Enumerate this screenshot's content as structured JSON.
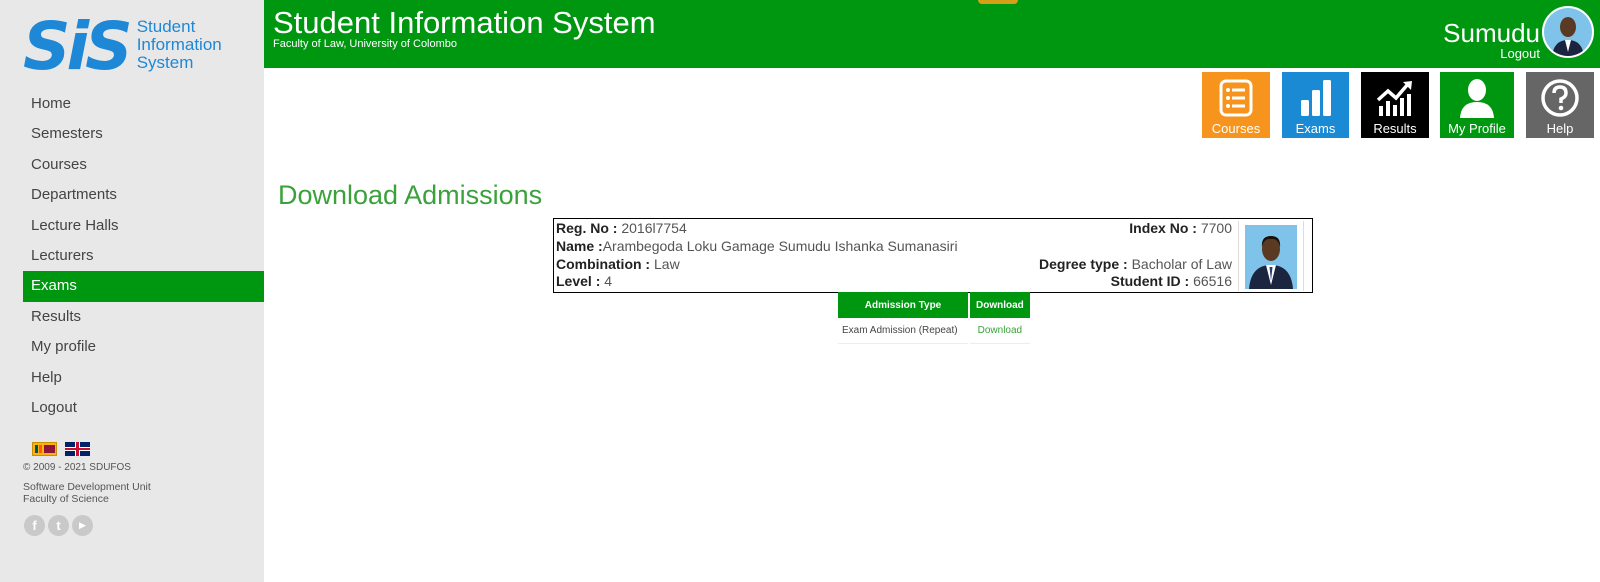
{
  "logo": {
    "mark": "SiS",
    "line1": "Student",
    "line2": "Information",
    "line3": "System"
  },
  "nav": {
    "items": [
      "Home",
      "Semesters",
      "Courses",
      "Departments",
      "Lecture Halls",
      "Lecturers",
      "Exams",
      "Results",
      "My profile",
      "Help",
      "Logout"
    ],
    "active": "Exams"
  },
  "footer": {
    "copyright": "© 2009 - 2021 SDUFOS",
    "unit_line1": "Software Development Unit",
    "unit_line2": "Faculty of Science"
  },
  "social": {
    "facebook": "f",
    "twitter": "t",
    "youtube": "▶"
  },
  "header": {
    "title": "Student Information System",
    "subtitle": "Faculty of Law, University of Colombo",
    "user_name": "Sumudu",
    "logout": "Logout"
  },
  "tiles": [
    {
      "label": "Courses",
      "icon": "list-icon",
      "color": "#f7941d"
    },
    {
      "label": "Exams",
      "icon": "bar-chart-icon",
      "color": "#1a8ad4"
    },
    {
      "label": "Results",
      "icon": "trend-chart-icon",
      "color": "#000000"
    },
    {
      "label": "My Profile",
      "icon": "person-icon",
      "color": "#009710"
    },
    {
      "label": "Help",
      "icon": "help-icon",
      "color": "#666666"
    }
  ],
  "page": {
    "title": "Download Admissions"
  },
  "student": {
    "reg_label": "Reg. No : ",
    "reg_value": "2016l7754",
    "name_label": "Name :",
    "name_value": "Arambegoda Loku Gamage Sumudu Ishanka Sumanasiri",
    "combination_label": "Combination : ",
    "combination_value": "Law",
    "level_label": "Level : ",
    "level_value": "4",
    "index_label": "Index No : ",
    "index_value": "7700",
    "degree_label": "Degree type : ",
    "degree_value": "Bacholar of Law",
    "student_id_label": "Student ID : ",
    "student_id_value": "66516"
  },
  "admissions": {
    "headers": [
      "Admission Type",
      "Download"
    ],
    "rows": [
      {
        "type": "Exam Admission (Repeat)",
        "link": "Download"
      }
    ]
  }
}
